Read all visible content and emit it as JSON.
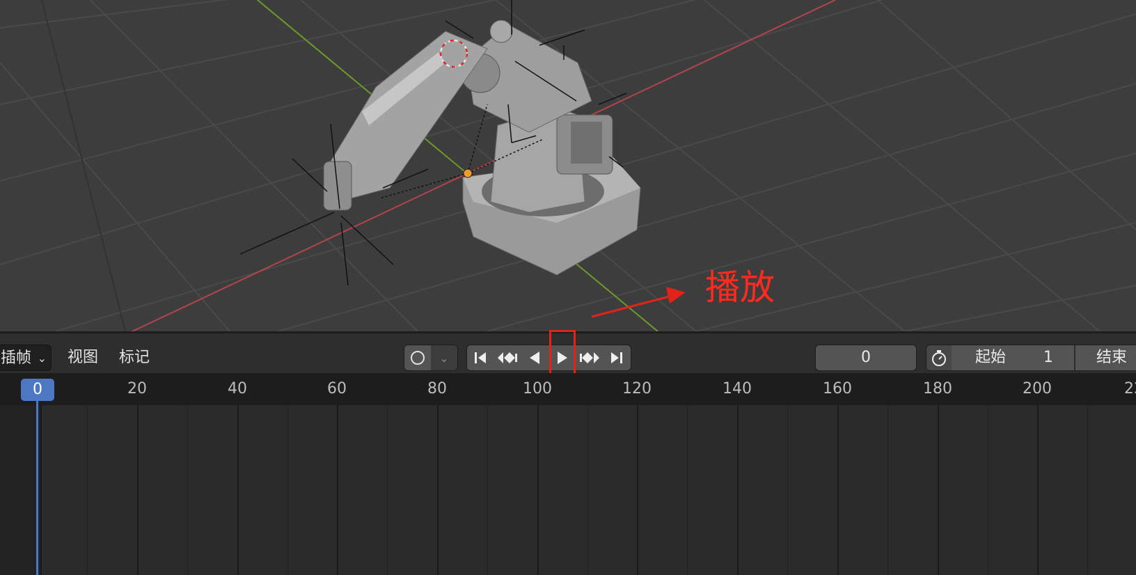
{
  "annotation": {
    "label": "播放",
    "color": "#ff2a1f"
  },
  "header": {
    "menu": {
      "label": "插帧",
      "chevron": "chevron-down-icon"
    },
    "view_label": "视图",
    "marker_label": "标记",
    "record_icon": "circle-icon",
    "record_chevron": "chevron-down-icon",
    "playback_buttons": [
      {
        "name": "jump-to-start",
        "icon": "jump-start-icon"
      },
      {
        "name": "prev-keyframe",
        "icon": "prev-keyframe-icon"
      },
      {
        "name": "play-reverse",
        "icon": "play-reverse-icon"
      },
      {
        "name": "play",
        "icon": "play-icon"
      },
      {
        "name": "next-keyframe",
        "icon": "next-keyframe-icon"
      },
      {
        "name": "jump-to-end",
        "icon": "jump-end-icon"
      }
    ],
    "current_frame_value": "0",
    "stopwatch_icon": "stopwatch-icon",
    "start_label": "起始",
    "start_value": "1",
    "end_label": "结束"
  },
  "ruler": {
    "current_frame": "0",
    "ticks": [
      "20",
      "40",
      "60",
      "80",
      "100",
      "120",
      "140",
      "160",
      "180",
      "200",
      "22"
    ]
  },
  "colors": {
    "accent": "#4b77c3",
    "highlight": "#e2231a",
    "x_axis": "#b2454c",
    "y_axis": "#6e9a2a"
  }
}
